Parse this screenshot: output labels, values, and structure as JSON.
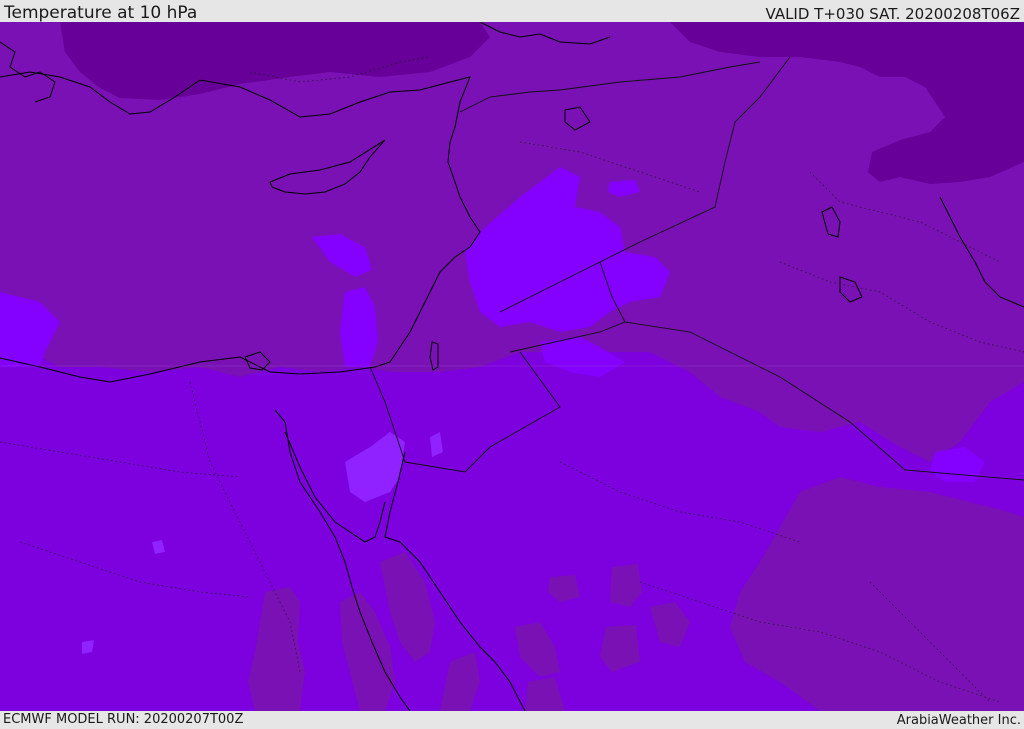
{
  "header": {
    "title": "Temperature at 10 hPa",
    "valid": "VALID T+030 SAT. 20200208T06Z"
  },
  "footer": {
    "model_run": "ECMWF MODEL RUN: 20200207T00Z",
    "credit": "ArabiaWeather Inc."
  },
  "colors": {
    "band_coldest": "#660099",
    "band_cold": "#7a11b4",
    "band_mid": "#7d00de",
    "band_warm": "#8400ff",
    "band_warmest": "#8f22ff",
    "coastline": "#000000",
    "border": "#111111"
  },
  "map": {
    "region": "Eastern Mediterranean, Middle East and Red Sea",
    "field": "temperature",
    "level": "10 hPa"
  }
}
